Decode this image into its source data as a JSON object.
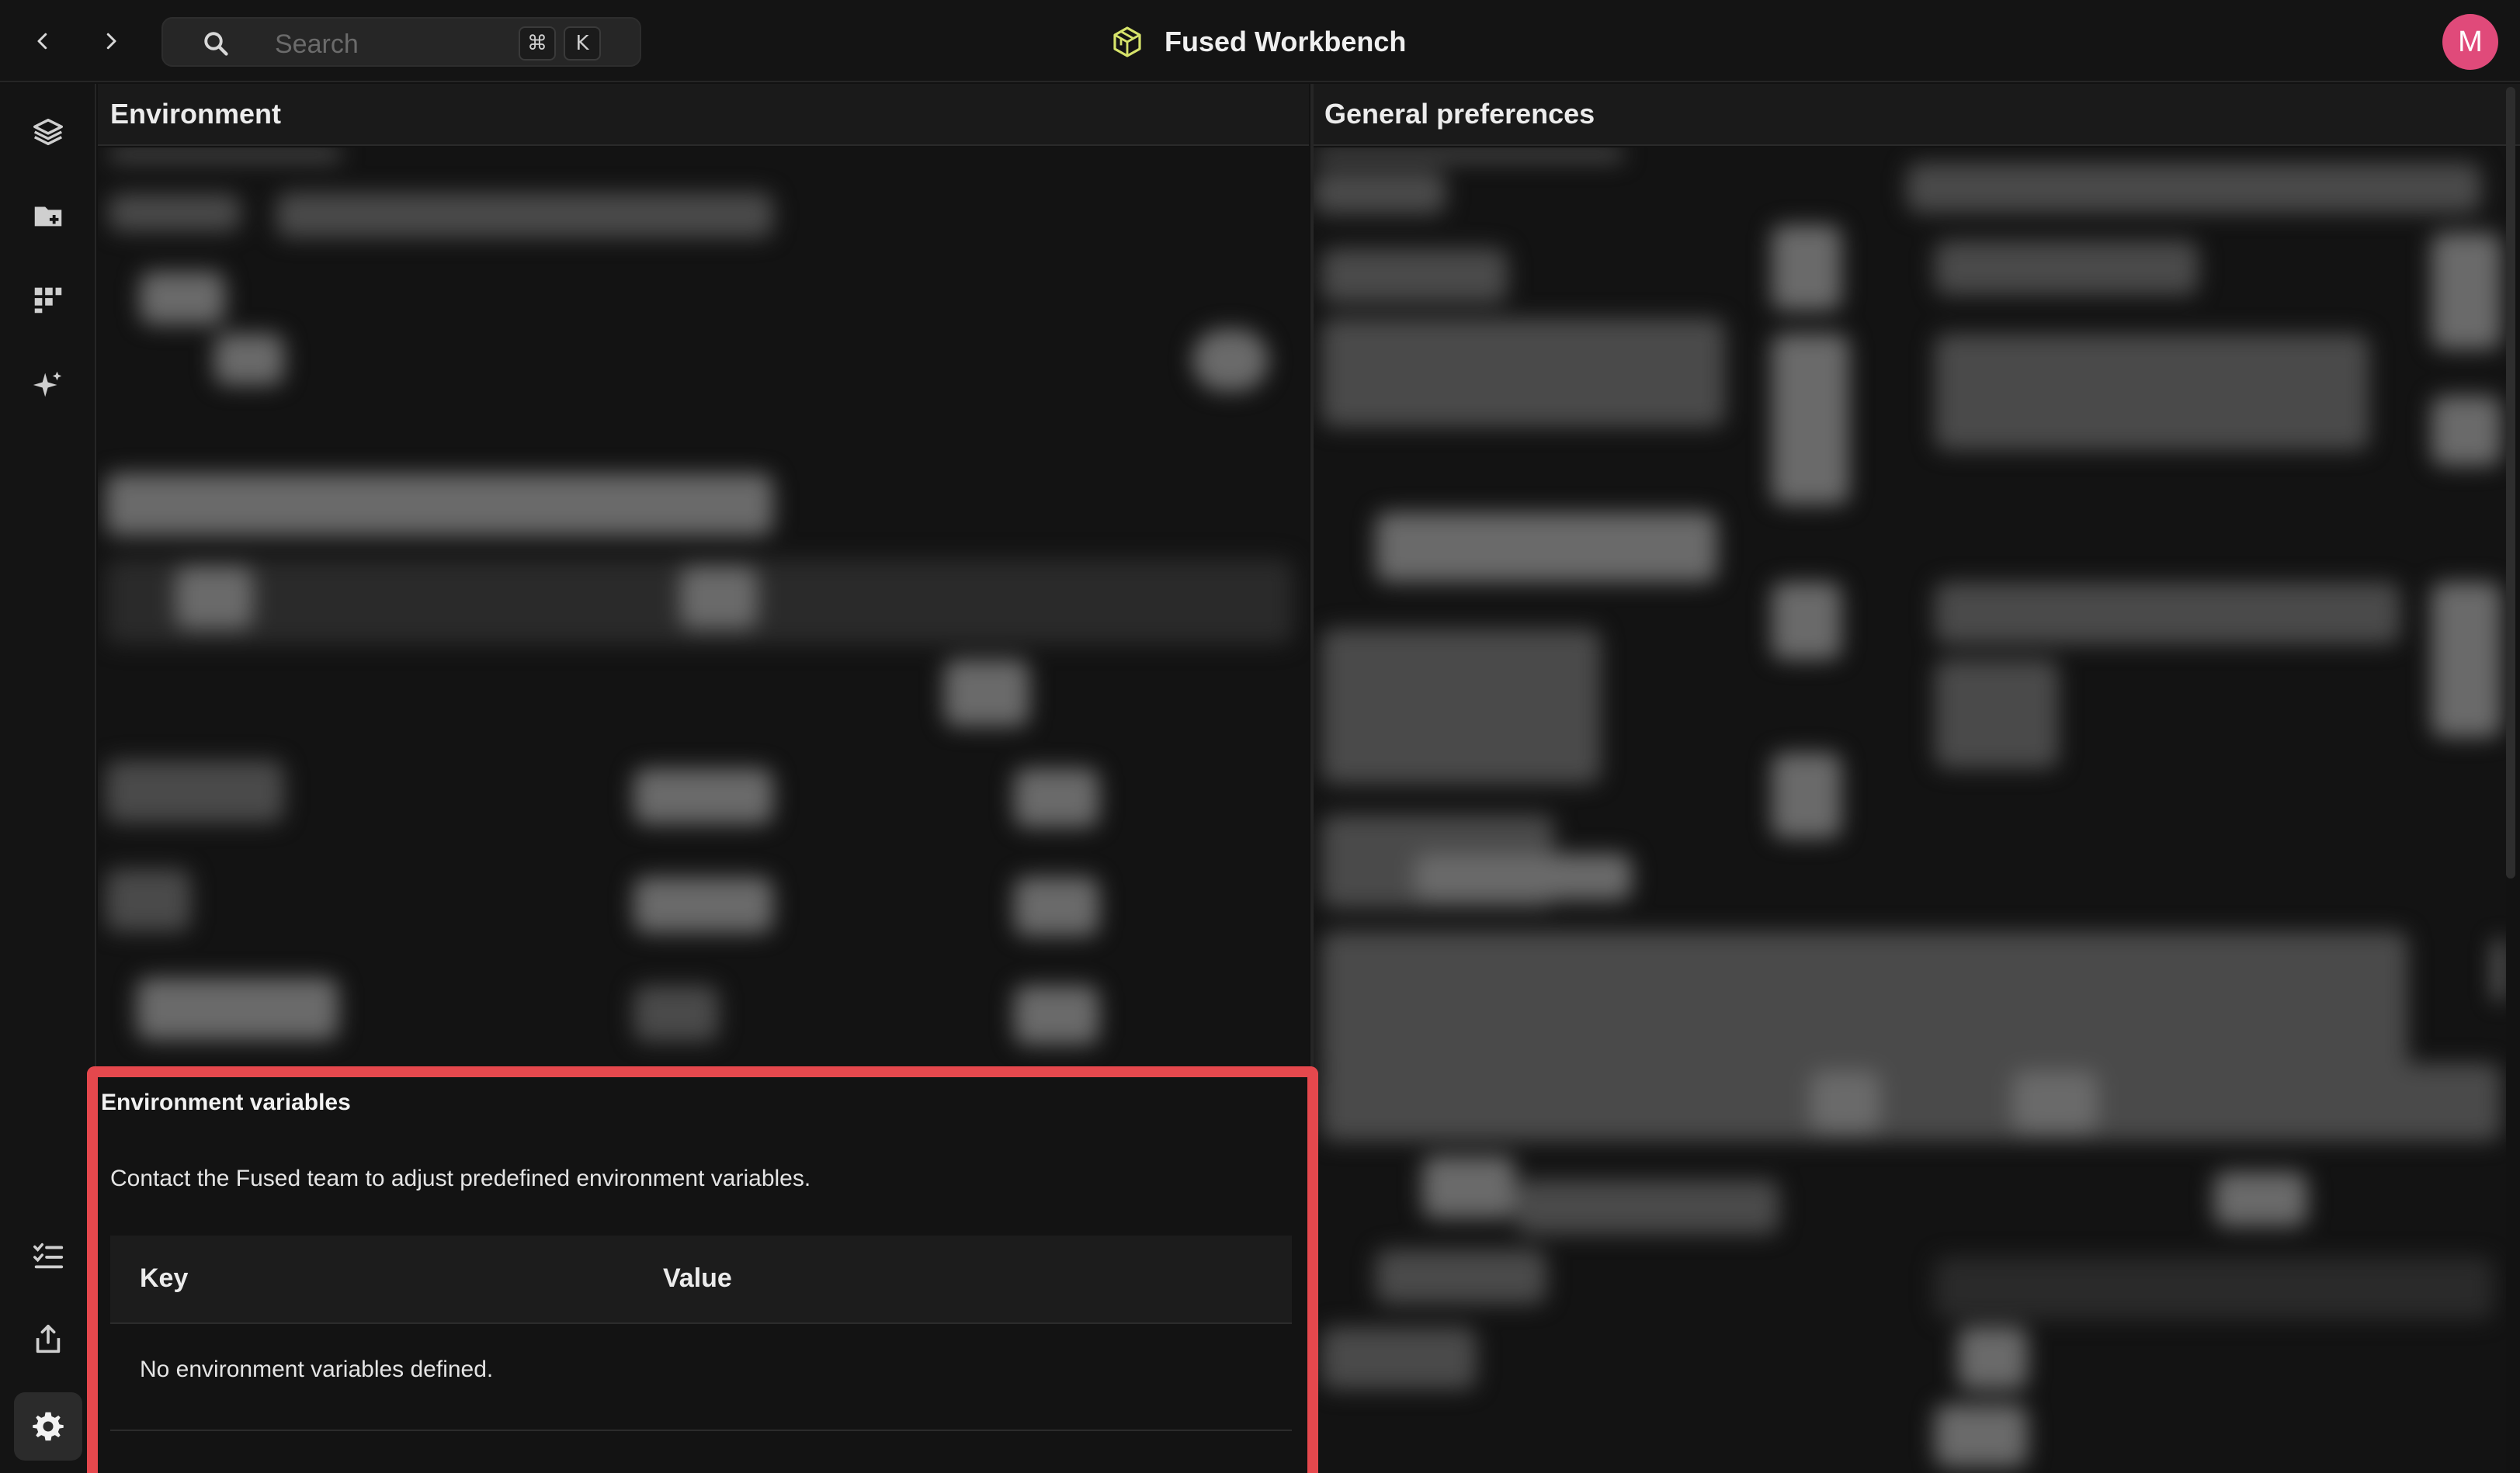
{
  "topbar": {
    "search_placeholder": "Search",
    "shortcut_modifier": "⌘",
    "shortcut_key": "K",
    "app_title": "Fused Workbench",
    "avatar_initial": "M",
    "avatar_color": "#e04a7a"
  },
  "icons": {
    "back": "chevron-left-icon",
    "forward": "chevron-right-icon",
    "search": "search-icon",
    "logo": "fused-cube-logo",
    "sidebar": [
      "layers-icon",
      "folder-add-icon",
      "grid-blocks-icon",
      "sparkle-icon",
      "checklist-icon",
      "share-icon",
      "gear-icon"
    ]
  },
  "panels": {
    "left_title": "Environment",
    "right_title": "General preferences"
  },
  "env_section": {
    "title": "Environment variables",
    "description": "Contact the Fused team to adjust predefined environment variables.",
    "columns": [
      "Key",
      "Value"
    ],
    "empty_message": "No environment variables defined.",
    "highlight_color": "#e5484d"
  }
}
